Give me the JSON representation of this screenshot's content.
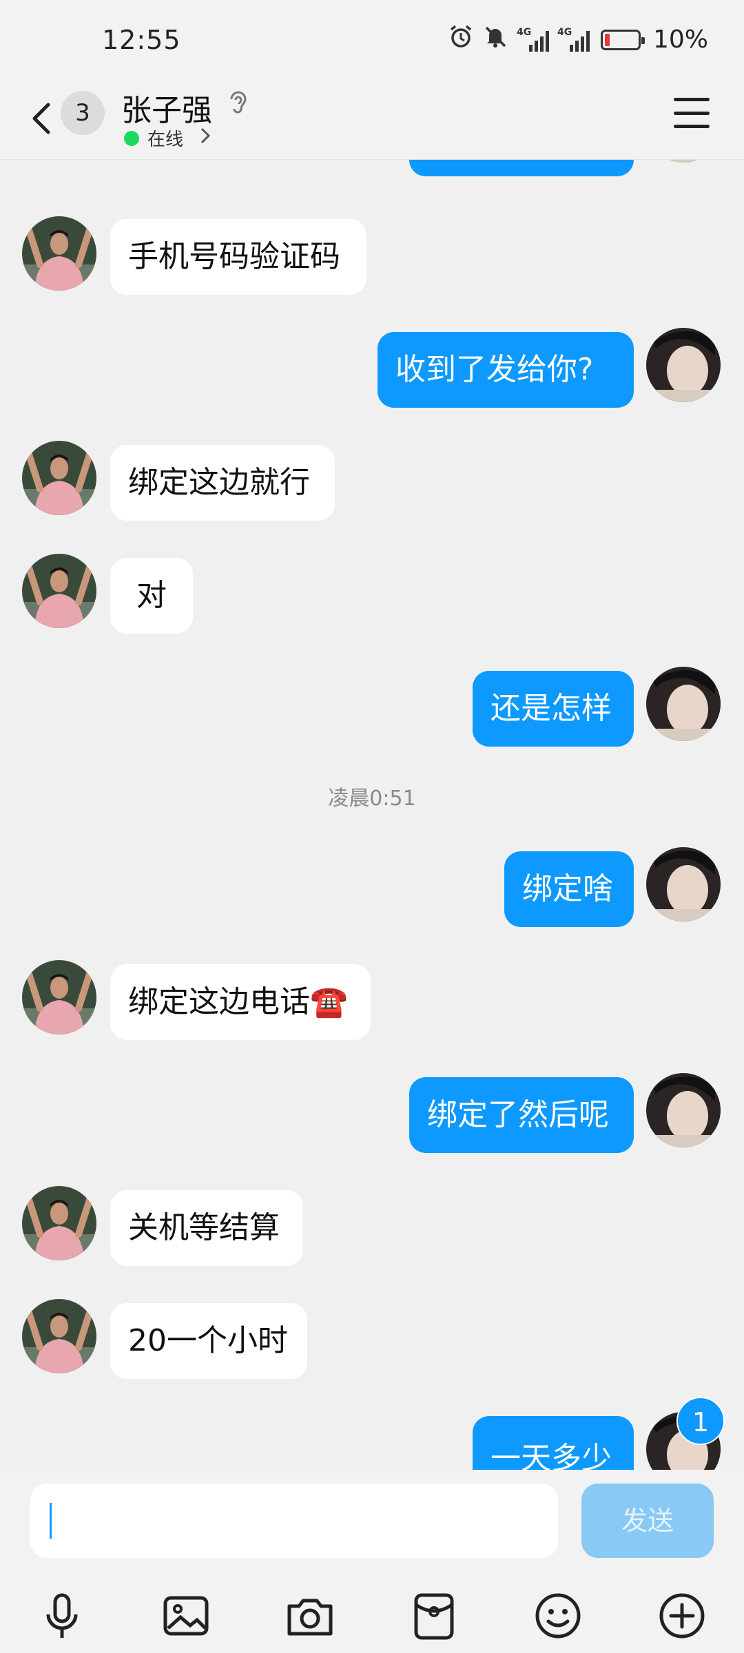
{
  "status_bar": {
    "time": "12:55",
    "signal1_tag": "4G",
    "signal2_tag": "4G",
    "battery_text": "10%",
    "icons": [
      "alarm-icon",
      "mute-icon",
      "signal-icon",
      "signal-icon",
      "battery-icon"
    ]
  },
  "header": {
    "unread_count": "3",
    "contact_name": "张子强",
    "status_text": "在线"
  },
  "chat": {
    "messages": [
      {
        "side": "out",
        "text": ""
      },
      {
        "side": "in",
        "text": "手机号码验证码"
      },
      {
        "side": "out",
        "text": "收到了发给你?"
      },
      {
        "side": "in",
        "text": "绑定这边就行"
      },
      {
        "side": "in",
        "text": "对"
      },
      {
        "side": "out",
        "text": "还是怎样"
      },
      {
        "side": "out",
        "text": "绑定啥"
      },
      {
        "side": "in",
        "text": "绑定这边电话☎️"
      },
      {
        "side": "out",
        "text": "绑定了然后呢"
      },
      {
        "side": "in",
        "text": "关机等结算"
      },
      {
        "side": "in",
        "text": "20一个小时"
      },
      {
        "side": "out",
        "text": "一天多少"
      }
    ],
    "timestamp": "凌晨0:51",
    "new_message_badge": "1"
  },
  "input": {
    "value": "",
    "send_label": "发送"
  },
  "toolbar": {
    "icons": [
      "microphone-icon",
      "image-icon",
      "camera-icon",
      "red-packet-icon",
      "emoji-icon",
      "plus-icon"
    ]
  },
  "colors": {
    "outgoing_bubble": "#0d99ff",
    "incoming_bubble": "#ffffff",
    "background": "#f0f0f0",
    "online_dot": "#1ed760",
    "send_disabled": "#88c9f5"
  }
}
